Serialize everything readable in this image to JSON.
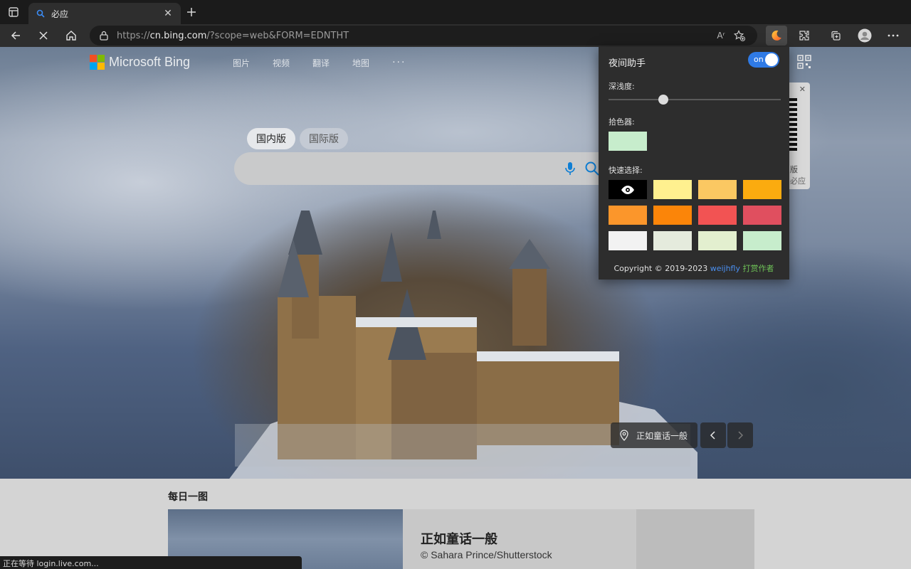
{
  "browser": {
    "tab_title": "必应",
    "tab_close": "✕",
    "url_scheme": "https://",
    "url_host": "cn.bing.com",
    "url_path": "/?scope=web&FORM=EDNTHT",
    "read_aloud": "Aʳ"
  },
  "bing": {
    "logo_text": "Microsoft Bing",
    "nav": [
      "图片",
      "视频",
      "翻译",
      "地图"
    ],
    "nav_more": "···",
    "scope": [
      "国内版",
      "国际版"
    ],
    "qr_card": {
      "close": "✕",
      "label_top": "版",
      "label_bottom": "必应"
    },
    "location": "正如童话一般",
    "daily": {
      "section_title": "每日一图",
      "heading": "正如童话一般",
      "credit": "© Sahara Prince/Shutterstock"
    },
    "logo_colors": [
      "#f25022",
      "#7fba00",
      "#00a4ef",
      "#ffb900"
    ]
  },
  "status_bar": "正在等待 login.live.com...",
  "extension": {
    "title": "夜间助手",
    "toggle_label": "on",
    "toggle_on": true,
    "depth_label": "深浅度:",
    "depth_value_percent": 32,
    "picker_label": "拾色器:",
    "picked_color": "#c7edcc",
    "quick_label": "快速选择:",
    "swatches": [
      "#000000",
      "#fff08f",
      "#fbc862",
      "#fbab0f",
      "#fb962b",
      "#fb8509",
      "#f25353",
      "#e04f5f",
      "#f2f2f2",
      "#e5ebdd",
      "#e3efcf",
      "#c7edcc"
    ],
    "copyright": "Copyright © 2019-2023",
    "author": "weijhfly",
    "donate": "打赏作者"
  },
  "colors": {
    "accent": "#2f7ae5",
    "author_link": "#4a8ff0",
    "donate_link": "#6ec257"
  }
}
